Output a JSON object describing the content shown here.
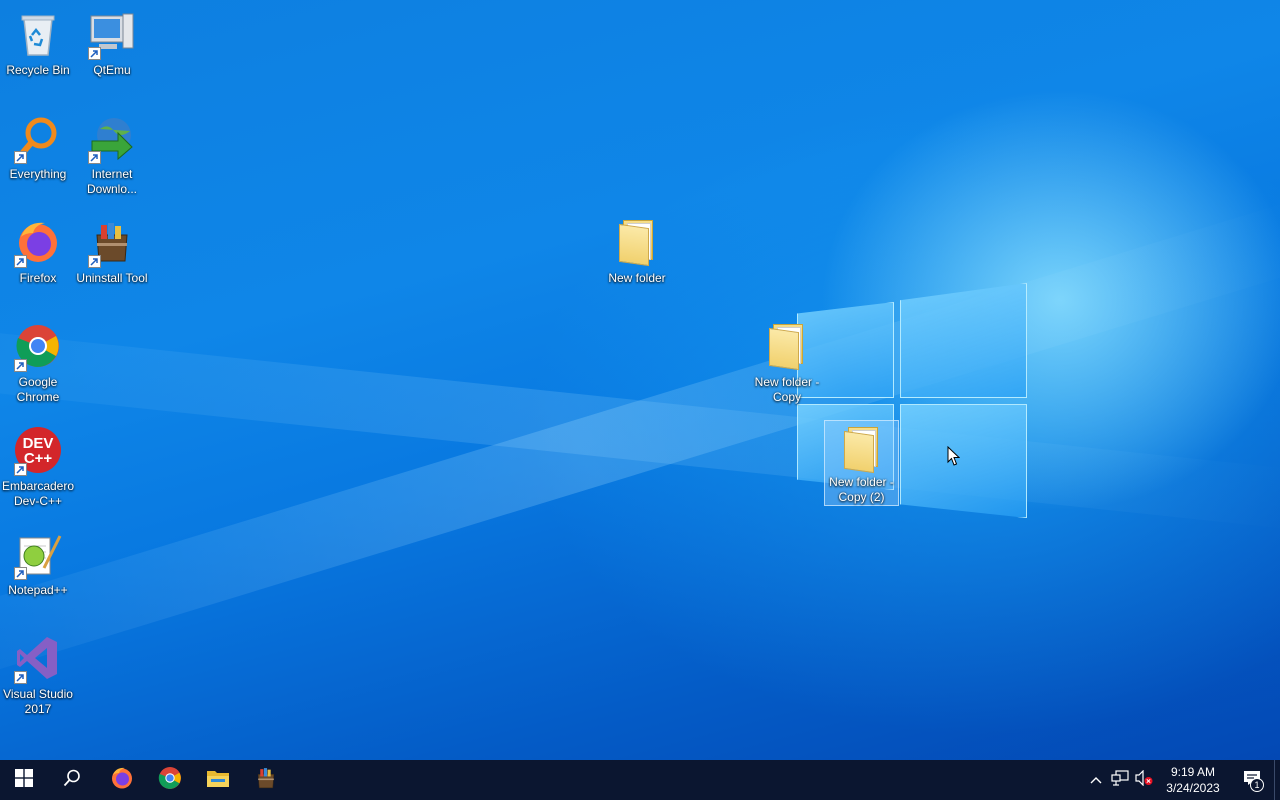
{
  "desktop": {
    "icons": [
      {
        "label": "Recycle Bin",
        "icon": "recycle-bin-icon"
      },
      {
        "label": "QtEmu",
        "icon": "qtemu-computer-icon"
      },
      {
        "label": "Everything",
        "icon": "everything-search-icon"
      },
      {
        "label": "Internet Downlo...",
        "icon": "internet-download-manager-icon"
      },
      {
        "label": "Firefox",
        "icon": "firefox-icon"
      },
      {
        "label": "Uninstall Tool",
        "icon": "uninstall-tool-icon"
      },
      {
        "label": "Google Chrome",
        "icon": "chrome-icon"
      },
      {
        "label": "Embarcadero Dev-C++",
        "icon": "devcpp-icon"
      },
      {
        "label": "Notepad++",
        "icon": "notepadpp-icon"
      },
      {
        "label": "Visual Studio 2017",
        "icon": "visual-studio-icon"
      },
      {
        "label": "New folder",
        "icon": "folder-icon"
      },
      {
        "label": "New folder - Copy",
        "icon": "folder-icon"
      },
      {
        "label": "New folder - Copy (2)",
        "icon": "folder-icon",
        "selected": true
      }
    ]
  },
  "taskbar": {
    "pinned": [
      "start-windows-icon",
      "search-icon",
      "firefox-icon",
      "chrome-icon",
      "file-explorer-icon",
      "uninstall-tool-icon"
    ],
    "tray": {
      "icons": [
        "chevron-up-icon",
        "network-icon",
        "volume-muted-icon"
      ],
      "time": "9:19 AM",
      "date": "3/24/2023",
      "notification_count": "1"
    }
  },
  "colors": {
    "taskbar": "#0b1630",
    "wallpaper_accent": "#0a6fd8"
  }
}
